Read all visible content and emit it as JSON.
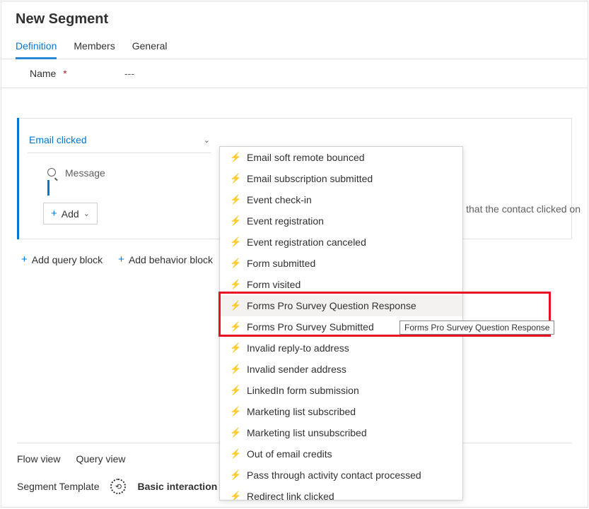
{
  "page": {
    "title": "New Segment"
  },
  "tabs": {
    "definition": "Definition",
    "members": "Members",
    "general": "General"
  },
  "name_field": {
    "label": "Name",
    "required_marker": "*",
    "value": "---"
  },
  "block": {
    "selected_behavior": "Email clicked",
    "message_label": "Message",
    "add_label": "Add",
    "hint_right": "ail that the contact clicked on"
  },
  "actions": {
    "add_query_block": "Add query block",
    "add_behavior_block": "Add behavior block"
  },
  "footer": {
    "flow_view": "Flow view",
    "query_view": "Query view",
    "template_label": "Segment Template",
    "template_value": "Basic interaction"
  },
  "menu": {
    "items": [
      "Email soft remote bounced",
      "Email subscription submitted",
      "Event check-in",
      "Event registration",
      "Event registration canceled",
      "Form submitted",
      "Form visited",
      "Forms Pro Survey Question Response",
      "Forms Pro Survey Submitted",
      "Invalid reply-to address",
      "Invalid sender address",
      "LinkedIn form submission",
      "Marketing list subscribed",
      "Marketing list unsubscribed",
      "Out of email credits",
      "Pass through activity contact processed",
      "Redirect link clicked"
    ],
    "hovered_index": 7
  },
  "tooltip": {
    "text": "Forms Pro Survey Question Response"
  }
}
